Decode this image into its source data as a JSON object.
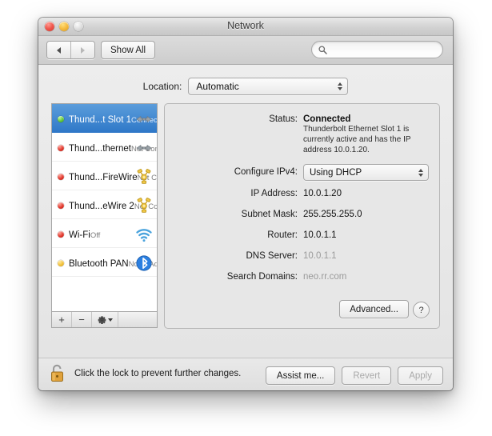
{
  "window": {
    "title": "Network",
    "traffic_lights": [
      "close",
      "minimize",
      "zoom"
    ]
  },
  "toolbar": {
    "back_icon": "back-arrow-icon",
    "forward_icon": "forward-arrow-icon",
    "show_all_label": "Show All",
    "search_icon": "search-icon",
    "search_value": "",
    "search_placeholder": ""
  },
  "location": {
    "label": "Location:",
    "value": "Automatic",
    "options": [
      "Automatic"
    ]
  },
  "sidebar": {
    "services": [
      {
        "name": "Thund...t Slot 1",
        "status": "Connected",
        "dot": "green",
        "icon": "thunderbolt-ethernet-icon",
        "selected": true
      },
      {
        "name": "Thund...thernet",
        "status": "Not Connected",
        "dot": "red",
        "icon": "thunderbolt-ethernet-icon",
        "selected": false
      },
      {
        "name": "Thund...FireWire",
        "status": "Not Connected",
        "dot": "red",
        "icon": "firewire-icon",
        "selected": false
      },
      {
        "name": "Thund...eWire 2",
        "status": "Not Connected",
        "dot": "red",
        "icon": "firewire-icon",
        "selected": false
      },
      {
        "name": "Wi-Fi",
        "status": "Off",
        "dot": "red",
        "icon": "wifi-icon",
        "selected": false
      },
      {
        "name": "Bluetooth PAN",
        "status": "No IP Address",
        "dot": "amber",
        "icon": "bluetooth-icon",
        "selected": false
      }
    ],
    "add_label": "+",
    "remove_label": "−",
    "action_icon": "gear-icon"
  },
  "detail": {
    "status_label": "Status:",
    "status_value": "Connected",
    "status_description": "Thunderbolt Ethernet Slot 1 is currently active and has the IP address 10.0.1.20.",
    "configure_label": "Configure IPv4:",
    "configure_value": "Using DHCP",
    "configure_options": [
      "Using DHCP"
    ],
    "ip_label": "IP Address:",
    "ip_value": "10.0.1.20",
    "subnet_label": "Subnet Mask:",
    "subnet_value": "255.255.255.0",
    "router_label": "Router:",
    "router_value": "10.0.1.1",
    "dns_label": "DNS Server:",
    "dns_value": "10.0.1.1",
    "search_domains_label": "Search Domains:",
    "search_domains_value": "neo.rr.com",
    "advanced_label": "Advanced...",
    "help_label": "?"
  },
  "footer": {
    "lock_icon": "unlocked-padlock-icon",
    "lock_text": "Click the lock to prevent further changes.",
    "assist_label": "Assist me...",
    "revert_label": "Revert",
    "apply_label": "Apply"
  },
  "colors": {
    "selection_blue": "#2f78c8",
    "connected_green": "#5ec63a",
    "disconnected_red": "#e0372c",
    "warning_amber": "#f2c13a",
    "bluetooth_blue": "#2b7fe0",
    "firewire_gold": "#e8c14a"
  }
}
